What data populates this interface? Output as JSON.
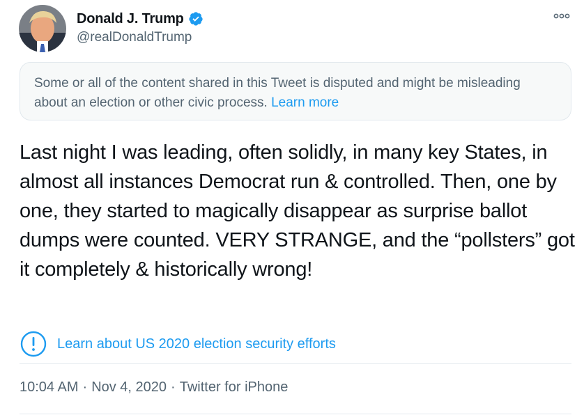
{
  "author": {
    "display_name": "Donald J. Trump",
    "handle": "@realDonaldTrump",
    "verified": true,
    "avatar_icon": "profile-photo"
  },
  "notice": {
    "text": "Some or all of the content shared in this Tweet is disputed and might be misleading about an election or other civic process.",
    "link_label": "Learn more"
  },
  "tweet": {
    "text": "Last night I was leading, often solidly, in many key States, in almost all instances Democrat run & controlled. Then, one by one, they started to magically disappear as surprise ballot dumps were counted. VERY STRANGE, and the “pollsters” got it completely & historically wrong!"
  },
  "election_link": {
    "label": "Learn about US 2020 election security efforts",
    "icon": "exclamation-circle-icon"
  },
  "meta": {
    "time": "10:04 AM",
    "date": "Nov 4, 2020",
    "source": "Twitter for iPhone",
    "separator": "·"
  },
  "colors": {
    "accent": "#1d9bf0",
    "text": "#0f1419",
    "secondary": "#536471",
    "border": "#e1e8ed",
    "notice_bg": "#f7f9f9"
  }
}
